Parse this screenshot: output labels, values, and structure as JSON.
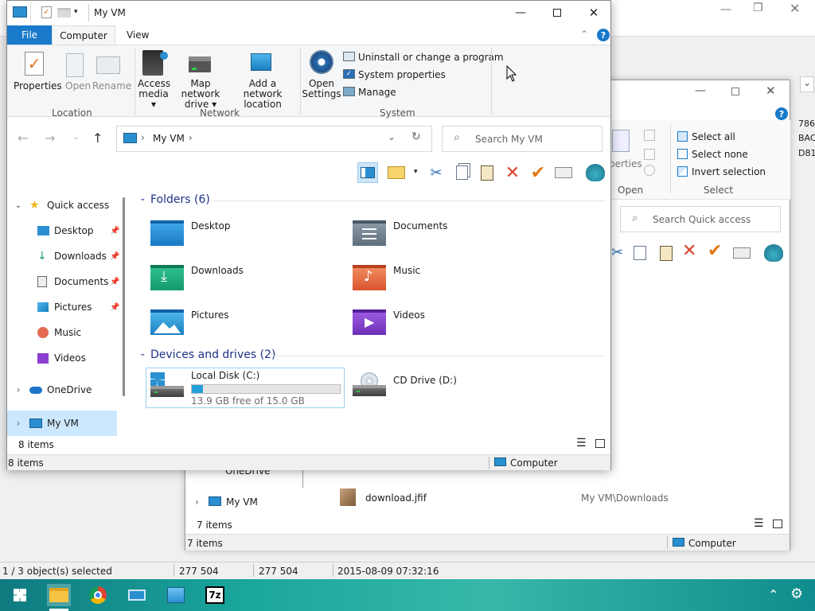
{
  "bg_app": {
    "status_selected": "1 / 3 object(s) selected",
    "status_size1": "277 504",
    "status_size2": "277 504",
    "status_date": "2015-08-09 07:32:16",
    "right_text": [
      "786",
      "BAC",
      "D81"
    ]
  },
  "win2": {
    "ribbon": {
      "properties_partial": "perties",
      "open_group": "Open",
      "select_all": "Select all",
      "select_none": "Select none",
      "invert_selection": "Invert selection",
      "select_group": "Select"
    },
    "search_placeholder": "Search Quick access",
    "nav_onedrive_partial": "OneDrive",
    "nav_myvm": "My VM",
    "file_name": "download.jfif",
    "file_location": "My VM\\Downloads",
    "items_inner": "7 items",
    "items_outer": "7 items",
    "status_location": "Computer"
  },
  "win1": {
    "title": "My VM",
    "tabs": {
      "file": "File",
      "computer": "Computer",
      "view": "View"
    },
    "ribbon": {
      "properties": "Properties",
      "open": "Open",
      "rename": "Rename",
      "location_group": "Location",
      "access_media": [
        "Access",
        "media ▾"
      ],
      "map_network_drive": [
        "Map network",
        "drive ▾"
      ],
      "add_network_location": [
        "Add a network",
        "location"
      ],
      "network_group": "Network",
      "open_settings": [
        "Open",
        "Settings"
      ],
      "uninstall": "Uninstall or change a program",
      "system_properties": "System properties",
      "manage": "Manage",
      "system_group": "System"
    },
    "address": {
      "crumb": "My VM"
    },
    "search_placeholder": "Search My VM",
    "nav": {
      "quick_access": "Quick access",
      "items": [
        "Desktop",
        "Downloads",
        "Documents",
        "Pictures",
        "Music",
        "Videos"
      ],
      "onedrive": "OneDrive",
      "my_vm": "My VM"
    },
    "folders_header": "Folders (6)",
    "folders": [
      "Desktop",
      "Documents",
      "Downloads",
      "Music",
      "Pictures",
      "Videos"
    ],
    "drives_header": "Devices and drives (2)",
    "drives": {
      "c_name": "Local Disk (C:)",
      "c_free": "13.9 GB free of 15.0 GB",
      "c_used_fraction": 0.073,
      "d_name": "CD Drive (D:)"
    },
    "items_inner": "8 items",
    "items_outer": "8 items",
    "status_location": "Computer"
  },
  "colors": {
    "accent": "#1979ca",
    "drive_bar": "#26a0da"
  }
}
